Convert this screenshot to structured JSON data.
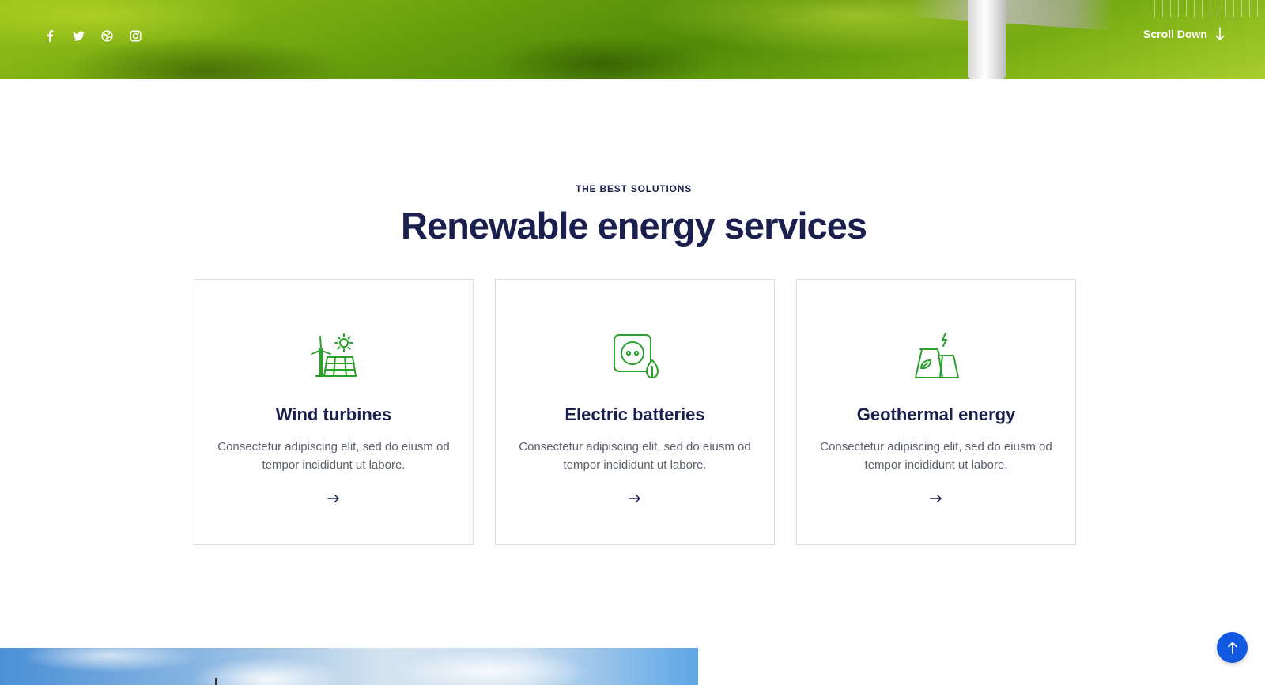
{
  "hero": {
    "social_icons": [
      "facebook-icon",
      "twitter-icon",
      "dribbble-icon",
      "instagram-icon"
    ],
    "scroll_down_label": "Scroll Down"
  },
  "services": {
    "eyebrow": "THE BEST SOLUTIONS",
    "heading": "Renewable energy services",
    "cards": [
      {
        "icon": "wind-solar-icon",
        "title": "Wind turbines",
        "text": "Consectetur adipiscing elit, sed do eiusm od tempor incididunt ut labore."
      },
      {
        "icon": "eco-socket-icon",
        "title": "Electric batteries",
        "text": "Consectetur adipiscing elit, sed do eiusm od tempor incididunt ut labore."
      },
      {
        "icon": "geothermal-plant-icon",
        "title": "Geothermal energy",
        "text": "Consectetur adipiscing elit, sed do eiusm od tempor incididunt ut labore."
      }
    ]
  },
  "colors": {
    "navy": "#1a1f4e",
    "icon_green": "#2aa12a",
    "accent_blue": "#1159e0",
    "body_text": "#5b5f6e"
  }
}
